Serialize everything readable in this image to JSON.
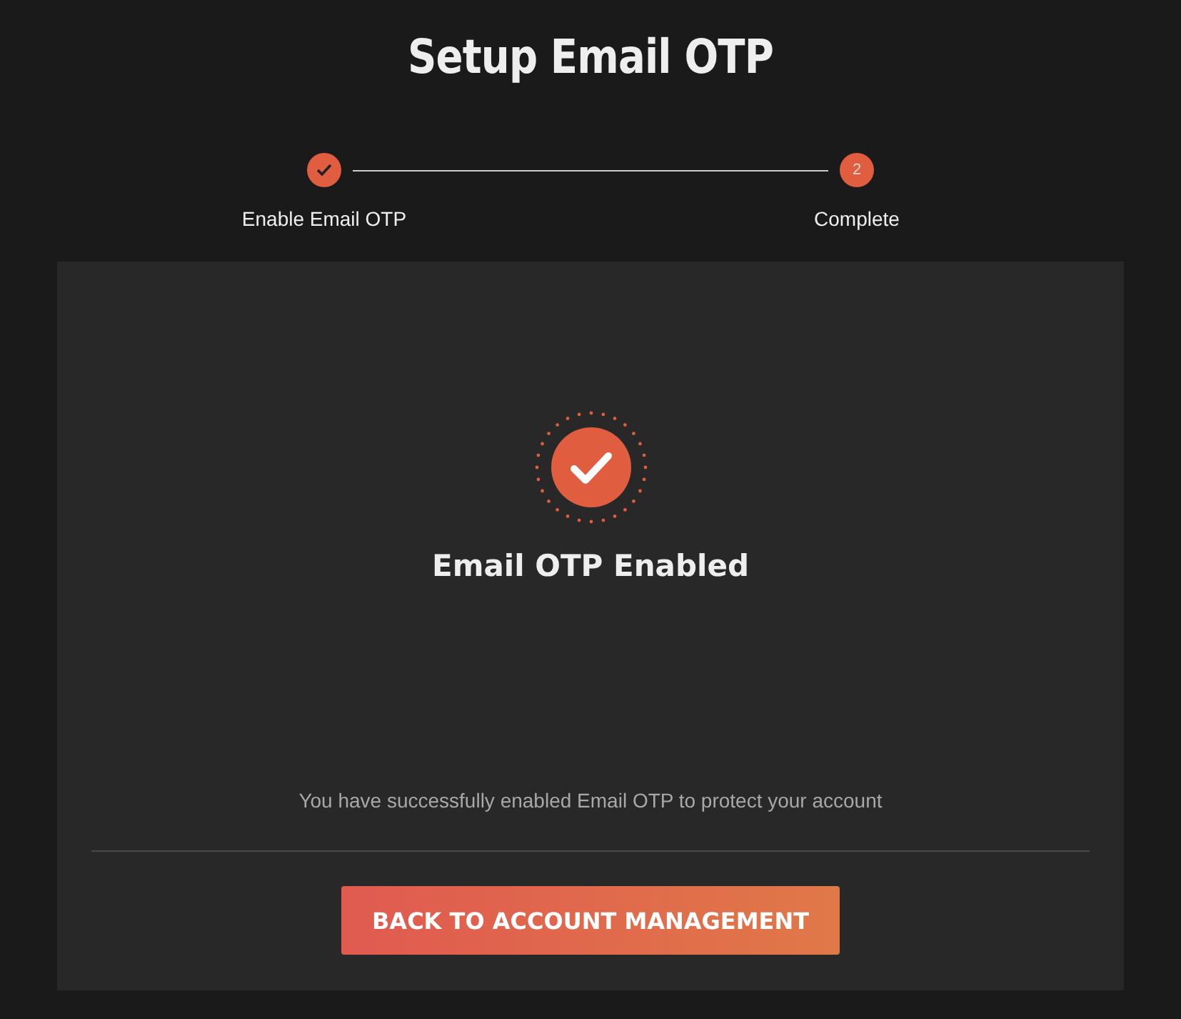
{
  "title": "Setup Email OTP",
  "steps": [
    {
      "label": "Enable Email OTP",
      "done": true
    },
    {
      "label": "Complete",
      "number": "2",
      "done": false
    }
  ],
  "card": {
    "heading": "Email OTP Enabled",
    "message": "You have successfully enabled Email OTP to protect your account",
    "button": "BACK TO ACCOUNT MANAGEMENT"
  }
}
